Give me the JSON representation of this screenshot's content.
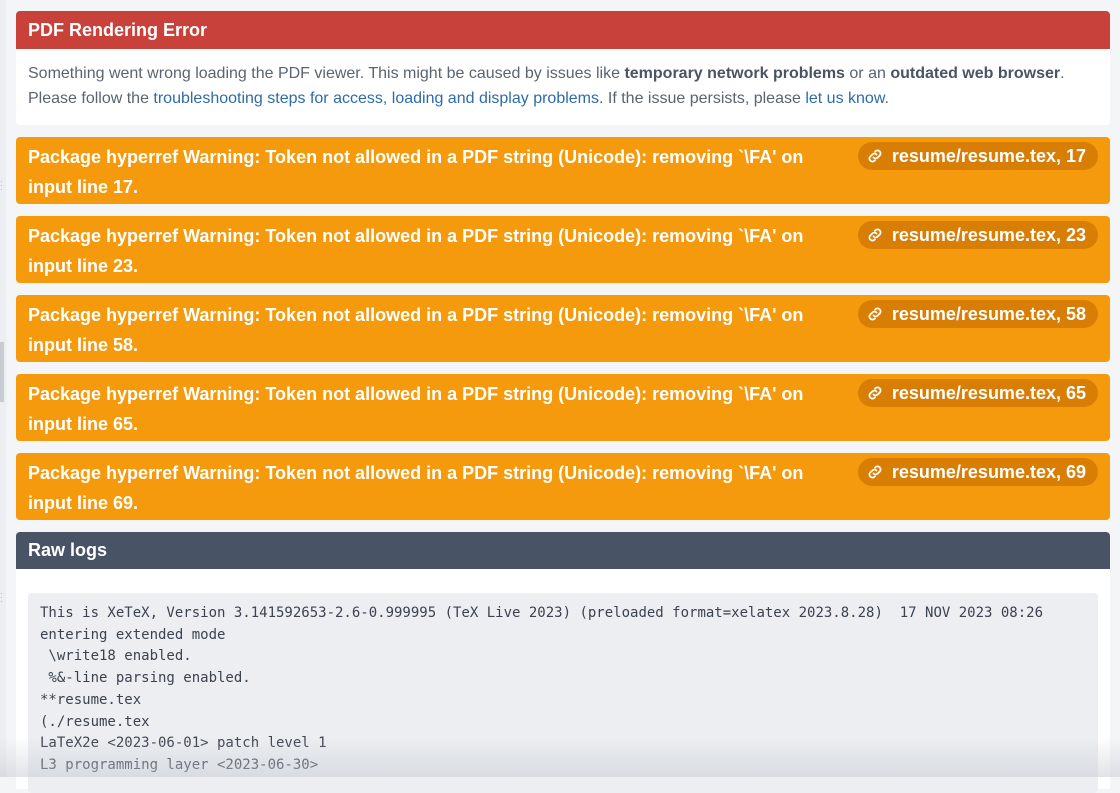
{
  "error": {
    "title": "PDF Rendering Error",
    "line1_pre": "Something went wrong loading the PDF viewer. This might be caused by issues like ",
    "line1_bold1": "temporary network problems",
    "line1_mid": " or an ",
    "line1_bold2": "outdated web browser",
    "line1_end": ".",
    "line2_pre": "Please follow the ",
    "line2_link1": "troubleshooting steps for access, loading and display problems",
    "line2_mid": ". If the issue persists, please ",
    "line2_link2": "let us know",
    "line2_end": "."
  },
  "warnings": [
    {
      "message": "Package hyperref Warning: Token not allowed in a PDF string (Unicode): removing `\\FA' on input line 17.",
      "location": "resume/resume.tex, 17"
    },
    {
      "message": "Package hyperref Warning: Token not allowed in a PDF string (Unicode): removing `\\FA' on input line 23.",
      "location": "resume/resume.tex, 23"
    },
    {
      "message": "Package hyperref Warning: Token not allowed in a PDF string (Unicode): removing `\\FA' on input line 58.",
      "location": "resume/resume.tex, 58"
    },
    {
      "message": "Package hyperref Warning: Token not allowed in a PDF string (Unicode): removing `\\FA' on input line 65.",
      "location": "resume/resume.tex, 65"
    },
    {
      "message": "Package hyperref Warning: Token not allowed in a PDF string (Unicode): removing `\\FA' on input line 69.",
      "location": "resume/resume.tex, 69"
    }
  ],
  "raw_logs": {
    "title": "Raw logs",
    "content": "This is XeTeX, Version 3.141592653-2.6-0.999995 (TeX Live 2023) (preloaded format=xelatex 2023.8.28)  17 NOV 2023 08:26\nentering extended mode\n \\write18 enabled.\n %&-line parsing enabled.\n**resume.tex\n(./resume.tex\nLaTeX2e <2023-06-01> patch level 1\nL3 programming layer <2023-06-30>"
  },
  "colors": {
    "error_header": "#c9413b",
    "warning": "#f49a0c",
    "warning_pill": "#d97e05",
    "logs_header": "#485466",
    "link": "#2e6ca8"
  },
  "icons": {
    "warning_link": "link-icon"
  }
}
